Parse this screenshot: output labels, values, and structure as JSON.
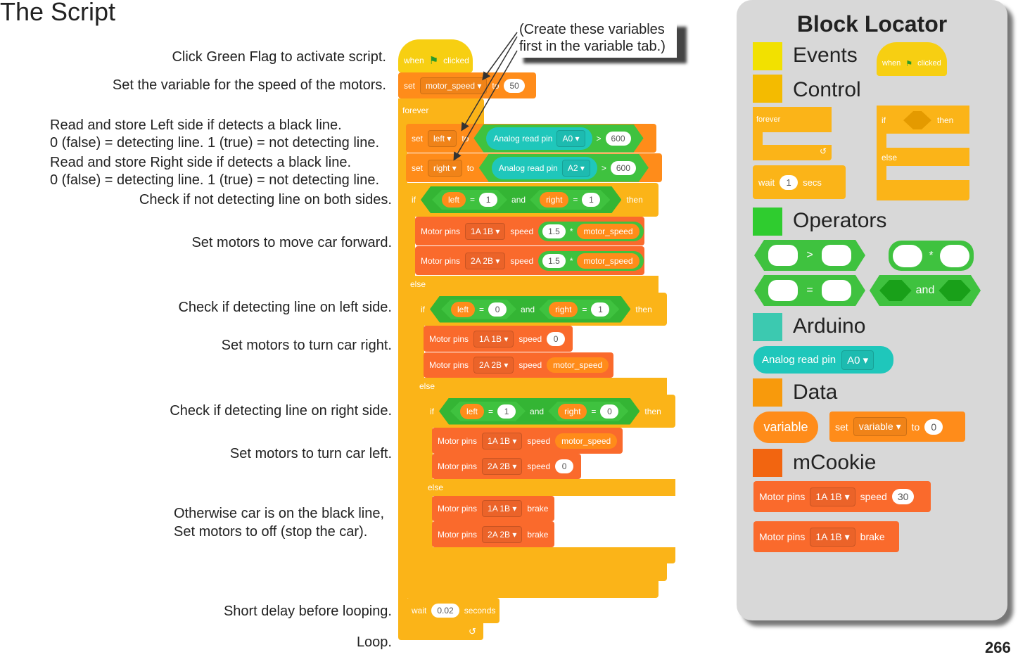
{
  "page_title": "The Script",
  "page_number": "266",
  "callout": [
    "(Create these variables",
    "first in the variable tab.)"
  ],
  "notes": {
    "flag": "Click Green Flag to activate script.",
    "speed": "Set the variable for the speed of the motors.",
    "left1": "Read and store Left side if detects a black line.",
    "left2": "0 (false) = detecting line. 1 (true) = not detecting line.",
    "right1": "Read and store Right side if detects a black line.",
    "right2": "0 (false) = detecting line. 1 (true) = not detecting line.",
    "both": "Check if not detecting line on both sides.",
    "forward": "Set motors to move car forward.",
    "leftside": "Check if detecting line on left side.",
    "turnright": "Set motors to turn car right.",
    "rightside": "Check if detecting line on right side.",
    "turnleft": "Set motors to turn car left.",
    "otherwise1": "Otherwise car is on the black line,",
    "otherwise2": "Set motors to off (stop the car).",
    "delay": "Short delay before looping.",
    "loop": "Loop."
  },
  "labels": {
    "when": "when",
    "clicked": "clicked",
    "set": "set",
    "to": "to",
    "forever": "forever",
    "analog": "Analog read pin",
    "gt": ">",
    "eq": "=",
    "and": "and",
    "if": "if",
    "then": "then",
    "else": "else",
    "motor_pins": "Motor pins",
    "speed": "speed",
    "times": "*",
    "brake": "brake",
    "wait": "wait",
    "seconds": "seconds",
    "secs": "secs",
    "motor_speed": "motor_speed",
    "left": "left",
    "right": "right",
    "p1": "1A 1B",
    "p2": "2A 2B",
    "a0": "A0",
    "a2": "A2"
  },
  "values": {
    "speed": "50",
    "threshold": "600",
    "mult": "1.5",
    "one": "1",
    "zero": "0",
    "delay": "0.02"
  },
  "locator": {
    "title": "Block Locator",
    "categories": [
      {
        "name": "Events",
        "color": "#f2e100"
      },
      {
        "name": "Control",
        "color": "#f4bb00"
      },
      {
        "name": "Operators",
        "color": "#2fcc2f"
      },
      {
        "name": "Arduino",
        "color": "#3cc9b0"
      },
      {
        "name": "Data",
        "color": "#f89a0c"
      },
      {
        "name": "mCookie",
        "color": "#f26510"
      }
    ],
    "wait_value": "1",
    "variable": "variable",
    "set_value": "0",
    "speed_value": "30"
  },
  "colors": {
    "events": "#f7cf12",
    "control": "#fbb418",
    "variables": "#ff8c1a",
    "mcookie": "#fa6a2c",
    "operators": "#3fc23f",
    "arduino": "#1fc7bb"
  }
}
